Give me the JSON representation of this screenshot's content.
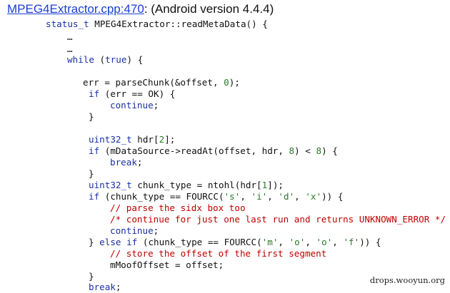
{
  "header": {
    "file_link": "MPEG4Extractor.cpp:470",
    "suffix": ": (Android version 4.4.4)"
  },
  "code": {
    "lines": [
      "status_t MPEG4Extractor::readMetaData() {",
      "…",
      "…",
      "while (true) {",
      "err = parseChunk(&offset, 0);",
      "if (err == OK) {",
      "continue;",
      "}",
      "uint32_t hdr[2];",
      "if (mDataSource->readAt(offset, hdr, 8) < 8) {",
      "break;",
      "}",
      "uint32_t chunk_type = ntohl(hdr[1]);",
      "if (chunk_type == FOURCC('s', 'i', 'd', 'x')) {",
      "// parse the sidx box too",
      "/* continue for just one last run and returns UNKNOWN_ERROR */",
      "continue;",
      "} else if (chunk_type == FOURCC('m', 'o', 'o', 'f')) {",
      "// store the offset of the first segment",
      "mMoofOffset = offset;",
      "}",
      "break;"
    ]
  },
  "watermark": "drops.wooyun.org"
}
